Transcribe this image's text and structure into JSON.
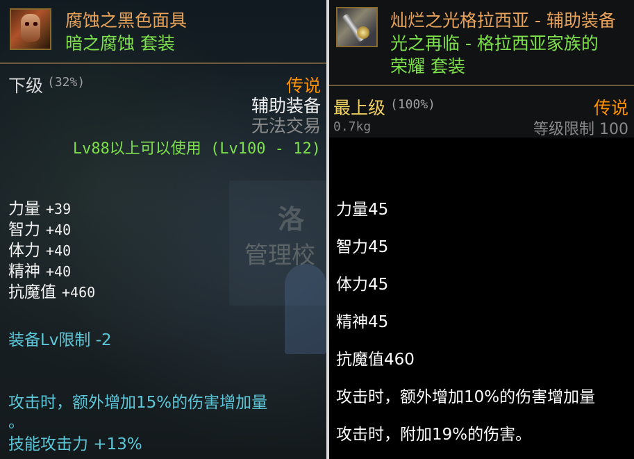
{
  "left": {
    "item_name": "腐蚀之黑色面具",
    "set_name": "暗之腐蚀  套装",
    "grade": "下级",
    "grade_pct": "(32%)",
    "rarity": "传说",
    "type": "辅助装备",
    "trade": "无法交易",
    "level_req": "Lv88以上可以使用 (Lv100 - 12)",
    "stats": [
      {
        "name": "力量",
        "value": "+39"
      },
      {
        "name": "智力",
        "value": "+40"
      },
      {
        "name": "体力",
        "value": "+40"
      },
      {
        "name": "精神",
        "value": "+40"
      },
      {
        "name": "抗魔值",
        "value": "+460"
      }
    ],
    "equip_limit": "装备Lv限制 -2",
    "effect_line1": "攻击时，额外增加15%的伤害增加量",
    "effect_line2": "。",
    "skill_attack": "技能攻击力 +13%",
    "bg_sign": "管理校",
    "bg_sign2": "洛"
  },
  "right": {
    "item_name_line1": "灿烂之光格拉西亚 - 辅助装备",
    "item_name_line2": "光之再临 - 格拉西亚家族的",
    "item_name_line3": "荣耀 套装",
    "grade": "最上级",
    "grade_pct": "(100%)",
    "rarity": "传说",
    "weight": "0.7kg",
    "level_limit": "等级限制 100",
    "stats": [
      "力量45",
      "智力45",
      "体力45",
      "精神45",
      "抗魔值460"
    ],
    "effects": [
      "攻击时，额外增加10%的伤害增加量",
      "攻击时，附加19%的伤害。"
    ]
  }
}
